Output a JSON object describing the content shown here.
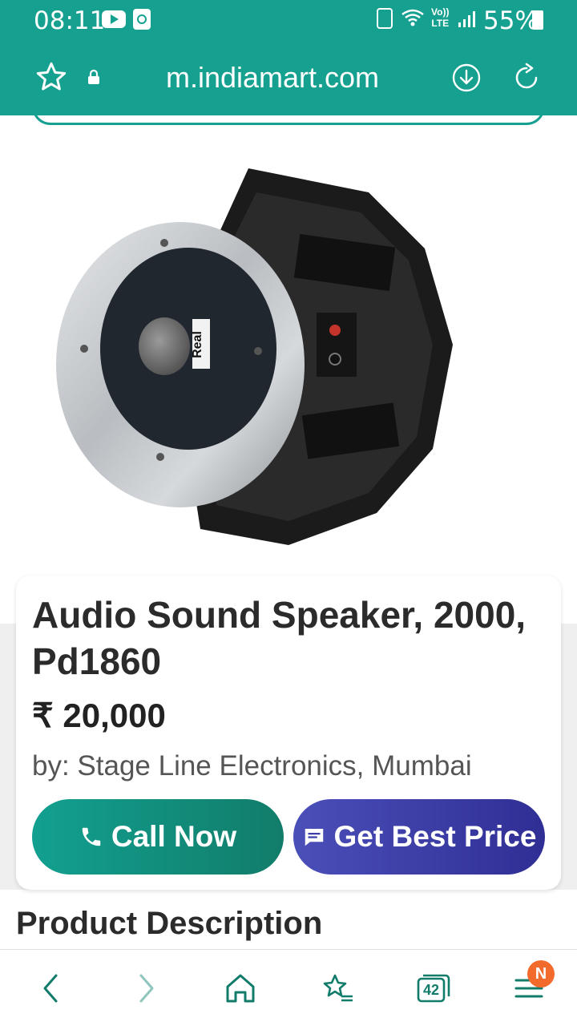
{
  "status_bar": {
    "time": "08:11",
    "battery_percent": "55%",
    "volte_line1": "Vo))",
    "volte_line2": "LTE"
  },
  "browser": {
    "url": "m.indiamart.com",
    "tab_count": "42",
    "menu_badge": "N"
  },
  "product": {
    "title": "Audio Sound Speaker, 2000, Pd1860",
    "price": "₹ 20,000",
    "seller": "by: Stage Line Electronics, Mumbai",
    "call_button": "Call Now",
    "price_button": "Get Best Price",
    "image_brand_label": "Real"
  },
  "section": {
    "description_heading": "Product Description"
  },
  "colors": {
    "brand_teal": "#16a08f",
    "call_button": "#12a090",
    "price_button": "#3b3ea8",
    "badge": "#f26b2c"
  },
  "icons": {
    "star": "star-outline-icon",
    "lock": "lock-icon",
    "download": "download-icon",
    "reload": "reload-icon",
    "back": "chevron-left-icon",
    "forward": "chevron-right-icon",
    "home": "home-icon",
    "bookmarks": "bookmark-star-icon",
    "tabs": "tabs-icon",
    "menu": "hamburger-menu-icon",
    "phone": "phone-icon",
    "chat": "chat-icon"
  }
}
